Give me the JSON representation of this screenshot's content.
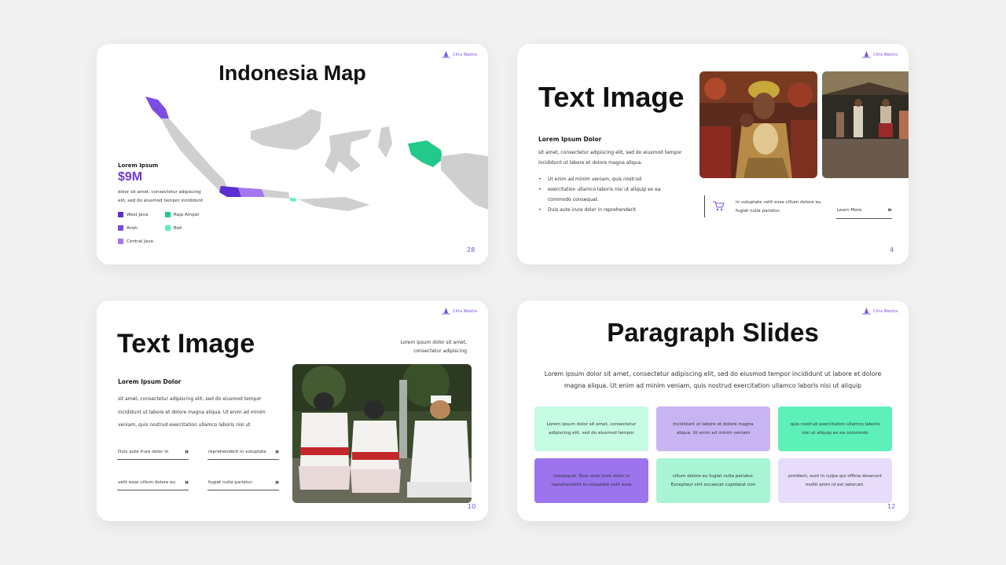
{
  "brand": {
    "name": "Citra Wastra",
    "color": "#7b4de3"
  },
  "colors": {
    "purple_dark": "#5b2fd1",
    "purple": "#7b4de3",
    "purple_light": "#c9b4f3",
    "lavender": "#e8dcfb",
    "green": "#22c98a",
    "green_light": "#bff7e2",
    "mint": "#5df0b8",
    "mint_light": "#c6fbe4"
  },
  "slide1": {
    "title": "Indonesia Map",
    "kpi_label": "Lorem Ipsum",
    "kpi_value": "$9M",
    "kpi_desc": "dolor sit amet, consectetur adipiscing elit, sed do eiusmod tempor incididunt",
    "legend": [
      {
        "label": "West Java",
        "color": "#5b2fd1"
      },
      {
        "label": "Aceh",
        "color": "#7b4de3"
      },
      {
        "label": "Central Java",
        "color": "#a678ef"
      },
      {
        "label": "Raja Ampat",
        "color": "#22c98a"
      },
      {
        "label": "Bali",
        "color": "#5df0b8"
      }
    ],
    "page": "28"
  },
  "slide2": {
    "title": "Text Image",
    "subtitle": "Lorem Ipsum Dolor",
    "paragraph": "sit amet, consectetur adipiscing elit, sed do eiusmod tempor incididunt ut labore et dolore magna aliqua.",
    "bullets": [
      "Ut enim ad minim veniam, quis nostrud",
      "exercitation ullamco laboris nisi ut aliquip ex ea commodo consequat.",
      "Duis aute irure dolor in reprehenderit"
    ],
    "info_icon": "cart-icon",
    "info_text": "in voluptate velit esse cillum dolore eu fugiat nulla pariatur.",
    "learn_more": "Learn More",
    "arrow": "»",
    "page": "4"
  },
  "slide3": {
    "title": "Text Image",
    "side_note": "Lorem ipsum dolor sit amet, consectetur adipiscing",
    "subtitle": "Lorem Ipsum Dolor",
    "paragraph": "sit amet, consectetur adipiscing elit, sed do eiusmod tempor incididunt ut labore et dolore magna aliqua. Ut enim ad minim veniam, quis nostrud exercitation ullamco laboris nisi ut",
    "links": [
      "Duis aute irure dolor in",
      "reprehenderit in voluptate",
      "velit esse cillum dolore eu",
      "fugiat nulla pariatur."
    ],
    "arrow": "»",
    "page": "10"
  },
  "slide4": {
    "title": "Paragraph Slides",
    "paragraph": "Lorem ipsum dolor sit amet, consectetur adipiscing elit, sed do eiusmod tempor incididunt ut labore et dolore magna aliqua. Ut enim ad minim veniam, quis nostrud exercitation ullamco laboris nisi ut aliquip",
    "cards": [
      {
        "text": "Lorem ipsum dolor sit amet, consectetur adipiscing elit, sed do eiusmod tempor",
        "color": "#c6fbe4"
      },
      {
        "text": "incididunt ut labore et dolore magna aliqua. Ut enim ad minim veniam",
        "color": "#c9b4f3"
      },
      {
        "text": "quis nostrud exercitation ullamco laboris nisi ut aliquip ex ea commodo",
        "color": "#5df0b8"
      },
      {
        "text": "consequat. Duis aute irure dolor in reprehenderit in voluptate velit esse",
        "color": "#9b74ee"
      },
      {
        "text": "cillum dolore eu fugiat nulla pariatur. Excepteur sint occaecat cupidatat non",
        "color": "#a8f4d4"
      },
      {
        "text": "proident, sunt in culpa qui officia deserunt mollit anim id est laborum.",
        "color": "#e8dcfb"
      }
    ],
    "page": "12"
  }
}
